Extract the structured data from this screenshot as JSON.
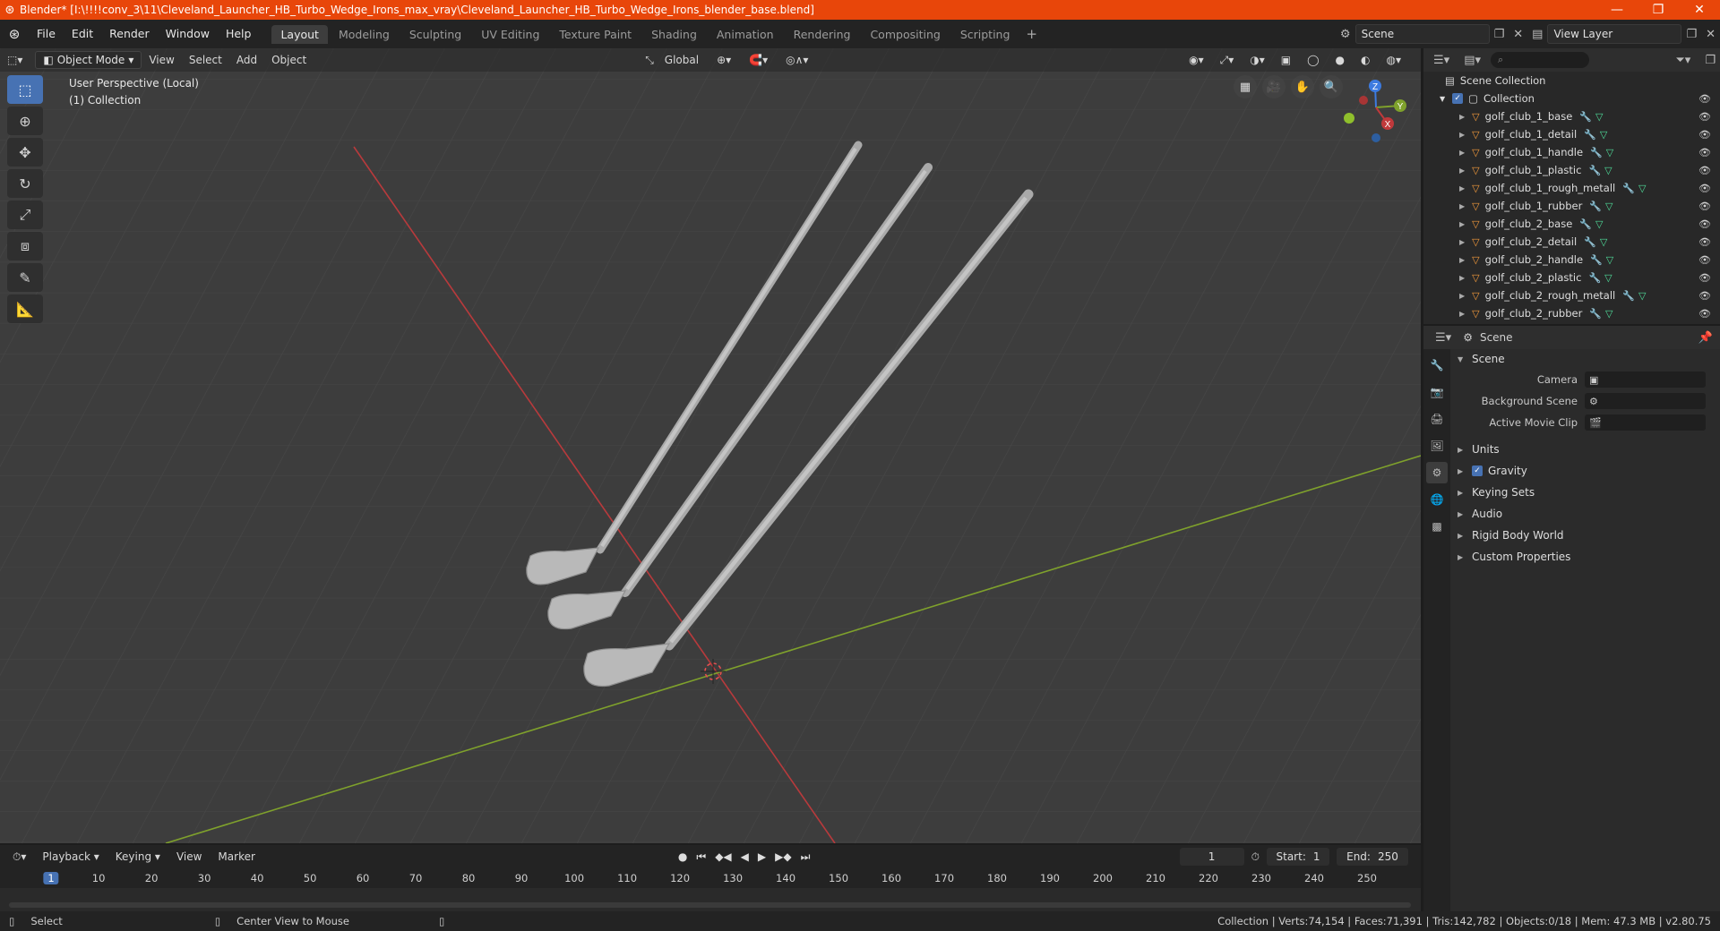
{
  "window": {
    "title": "Blender* [I:\\!!!!conv_3\\11\\Cleveland_Launcher_HB_Turbo_Wedge_Irons_max_vray\\Cleveland_Launcher_HB_Turbo_Wedge_Irons_blender_base.blend]"
  },
  "menu": {
    "items": [
      "File",
      "Edit",
      "Render",
      "Window",
      "Help"
    ]
  },
  "workspaces": {
    "tabs": [
      "Layout",
      "Modeling",
      "Sculpting",
      "UV Editing",
      "Texture Paint",
      "Shading",
      "Animation",
      "Rendering",
      "Compositing",
      "Scripting"
    ],
    "active": "Layout"
  },
  "scene_field": {
    "label": "Scene"
  },
  "view_layer_field": {
    "label": "View Layer"
  },
  "viewport": {
    "mode": "Object Mode",
    "menus": [
      "View",
      "Select",
      "Add",
      "Object"
    ],
    "orientation": "Global",
    "overlay_title": "User Perspective (Local)",
    "overlay_collection": "(1) Collection",
    "gizmo": {
      "x": "X",
      "y": "Y",
      "z": "Z"
    }
  },
  "outliner": {
    "scene_collection": "Scene Collection",
    "collection": "Collection",
    "objects": [
      "golf_club_1_base",
      "golf_club_1_detail",
      "golf_club_1_handle",
      "golf_club_1_plastic",
      "golf_club_1_rough_metall",
      "golf_club_1_rubber",
      "golf_club_2_base",
      "golf_club_2_detail",
      "golf_club_2_handle",
      "golf_club_2_plastic",
      "golf_club_2_rough_metall",
      "golf_club_2_rubber"
    ]
  },
  "properties": {
    "header": "Scene",
    "panel_title": "Scene",
    "rows": {
      "camera": "Camera",
      "background_scene": "Background Scene",
      "active_movie_clip": "Active Movie Clip"
    },
    "sub_panels": {
      "units": "Units",
      "gravity": "Gravity",
      "keying_sets": "Keying Sets",
      "audio": "Audio",
      "rigid_body_world": "Rigid Body World",
      "custom_properties": "Custom Properties"
    },
    "gravity_enabled": true
  },
  "timeline": {
    "menus": [
      "Playback",
      "Keying",
      "View",
      "Marker"
    ],
    "current_frame": "1",
    "start_label": "Start:",
    "start": "1",
    "end_label": "End:",
    "end": "250",
    "ticks": [
      "1",
      "10",
      "20",
      "30",
      "40",
      "50",
      "60",
      "70",
      "80",
      "90",
      "100",
      "110",
      "120",
      "130",
      "140",
      "150",
      "160",
      "170",
      "180",
      "190",
      "200",
      "210",
      "220",
      "230",
      "240",
      "250"
    ]
  },
  "statusbar": {
    "select": "Select",
    "center_view": "Center View to Mouse",
    "stats": "Collection | Verts:74,154 | Faces:71,391 | Tris:142,782 | Objects:0/18 | Mem: 47.3 MB | v2.80.75"
  },
  "colors": {
    "accent": "#4772b3",
    "titlebar": "#e8460a",
    "x_axis": "#c0393b",
    "y_axis": "#7fa12c"
  }
}
